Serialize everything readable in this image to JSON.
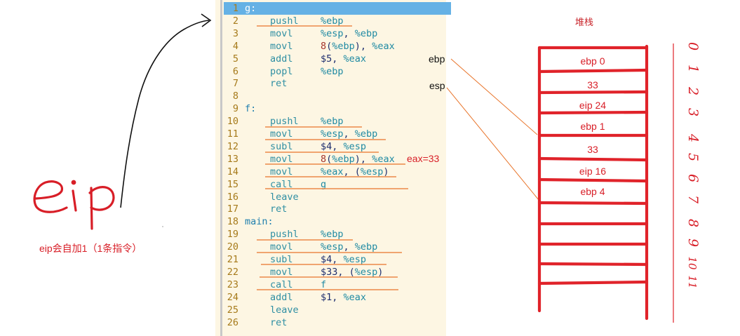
{
  "code": {
    "lines": [
      {
        "n": "1",
        "label": "g:",
        "op": "",
        "args": []
      },
      {
        "n": "2",
        "label": "",
        "op": "pushl",
        "args": [
          {
            "t": "%ebp",
            "c": "reg"
          }
        ]
      },
      {
        "n": "3",
        "label": "",
        "op": "movl",
        "args": [
          {
            "t": "%esp",
            "c": "reg"
          },
          {
            "t": ", ",
            "c": ""
          },
          {
            "t": "%ebp",
            "c": "reg"
          }
        ]
      },
      {
        "n": "4",
        "label": "",
        "op": "movl",
        "args": [
          {
            "t": "8",
            "c": "num"
          },
          {
            "t": "(",
            "c": ""
          },
          {
            "t": "%ebp",
            "c": "reg"
          },
          {
            "t": "), ",
            "c": ""
          },
          {
            "t": "%eax",
            "c": "reg"
          }
        ]
      },
      {
        "n": "5",
        "label": "",
        "op": "addl",
        "args": [
          {
            "t": "$5",
            "c": ""
          },
          {
            "t": ", ",
            "c": ""
          },
          {
            "t": "%eax",
            "c": "reg"
          }
        ]
      },
      {
        "n": "6",
        "label": "",
        "op": "popl",
        "args": [
          {
            "t": "%ebp",
            "c": "reg"
          }
        ]
      },
      {
        "n": "7",
        "label": "",
        "op": "ret",
        "args": []
      },
      {
        "n": "8",
        "label": "",
        "op": "",
        "args": []
      },
      {
        "n": "9",
        "label": "f:",
        "op": "",
        "args": []
      },
      {
        "n": "10",
        "label": "",
        "op": "pushl",
        "args": [
          {
            "t": "%ebp",
            "c": "reg"
          }
        ]
      },
      {
        "n": "11",
        "label": "",
        "op": "movl",
        "args": [
          {
            "t": "%esp",
            "c": "reg"
          },
          {
            "t": ", ",
            "c": ""
          },
          {
            "t": "%ebp",
            "c": "reg"
          }
        ]
      },
      {
        "n": "12",
        "label": "",
        "op": "subl",
        "args": [
          {
            "t": "$4",
            "c": ""
          },
          {
            "t": ", ",
            "c": ""
          },
          {
            "t": "%esp",
            "c": "reg"
          }
        ]
      },
      {
        "n": "13",
        "label": "",
        "op": "movl",
        "args": [
          {
            "t": "8",
            "c": "num"
          },
          {
            "t": "(",
            "c": ""
          },
          {
            "t": "%ebp",
            "c": "reg"
          },
          {
            "t": "), ",
            "c": ""
          },
          {
            "t": "%eax",
            "c": "reg"
          }
        ]
      },
      {
        "n": "14",
        "label": "",
        "op": "movl",
        "args": [
          {
            "t": "%eax",
            "c": "reg"
          },
          {
            "t": ", (",
            "c": ""
          },
          {
            "t": "%esp",
            "c": "reg"
          },
          {
            "t": ")",
            "c": ""
          }
        ]
      },
      {
        "n": "15",
        "label": "",
        "op": "call",
        "args": [
          {
            "t": "g",
            "c": "reg"
          }
        ]
      },
      {
        "n": "16",
        "label": "",
        "op": "leave",
        "args": []
      },
      {
        "n": "17",
        "label": "",
        "op": "ret",
        "args": []
      },
      {
        "n": "18",
        "label": "main:",
        "op": "",
        "args": []
      },
      {
        "n": "19",
        "label": "",
        "op": "pushl",
        "args": [
          {
            "t": "%ebp",
            "c": "reg"
          }
        ]
      },
      {
        "n": "20",
        "label": "",
        "op": "movl",
        "args": [
          {
            "t": "%esp",
            "c": "reg"
          },
          {
            "t": ", ",
            "c": ""
          },
          {
            "t": "%ebp",
            "c": "reg"
          }
        ]
      },
      {
        "n": "21",
        "label": "",
        "op": "subl",
        "args": [
          {
            "t": "$4",
            "c": ""
          },
          {
            "t": ", ",
            "c": ""
          },
          {
            "t": "%esp",
            "c": "reg"
          }
        ]
      },
      {
        "n": "22",
        "label": "",
        "op": "movl",
        "args": [
          {
            "t": "$33",
            "c": ""
          },
          {
            "t": ", (",
            "c": ""
          },
          {
            "t": "%esp",
            "c": "reg"
          },
          {
            "t": ")",
            "c": ""
          }
        ]
      },
      {
        "n": "23",
        "label": "",
        "op": "call",
        "args": [
          {
            "t": "f",
            "c": "reg"
          }
        ]
      },
      {
        "n": "24",
        "label": "",
        "op": "addl",
        "args": [
          {
            "t": "$1",
            "c": ""
          },
          {
            "t": ", ",
            "c": ""
          },
          {
            "t": "%eax",
            "c": "reg"
          }
        ]
      },
      {
        "n": "25",
        "label": "",
        "op": "leave",
        "args": []
      },
      {
        "n": "26",
        "label": "",
        "op": "ret",
        "args": []
      }
    ],
    "highlighted_line": "1"
  },
  "annotations": {
    "eax_note": "eax=33",
    "eip_handwritten": "eip",
    "eip_caption": "eip会自加1（1条指令）",
    "ebp_label": "ebp",
    "esp_label": "esp"
  },
  "stack": {
    "title": "堆栈",
    "cells": [
      "ebp 0",
      "33",
      "eip 24",
      "ebp 1",
      "33",
      "eip 16",
      "ebp 4",
      "",
      "",
      "",
      "",
      ""
    ],
    "index_labels": [
      "0",
      "1",
      "2",
      "3",
      "4",
      "5",
      "6",
      "7",
      "8",
      "9",
      "10",
      "11"
    ]
  },
  "colors": {
    "code_bg": "#fdf6e3",
    "highlight": "#65b1e5",
    "annotation_red": "#d81e27",
    "underline_orange": "#e8742a"
  }
}
